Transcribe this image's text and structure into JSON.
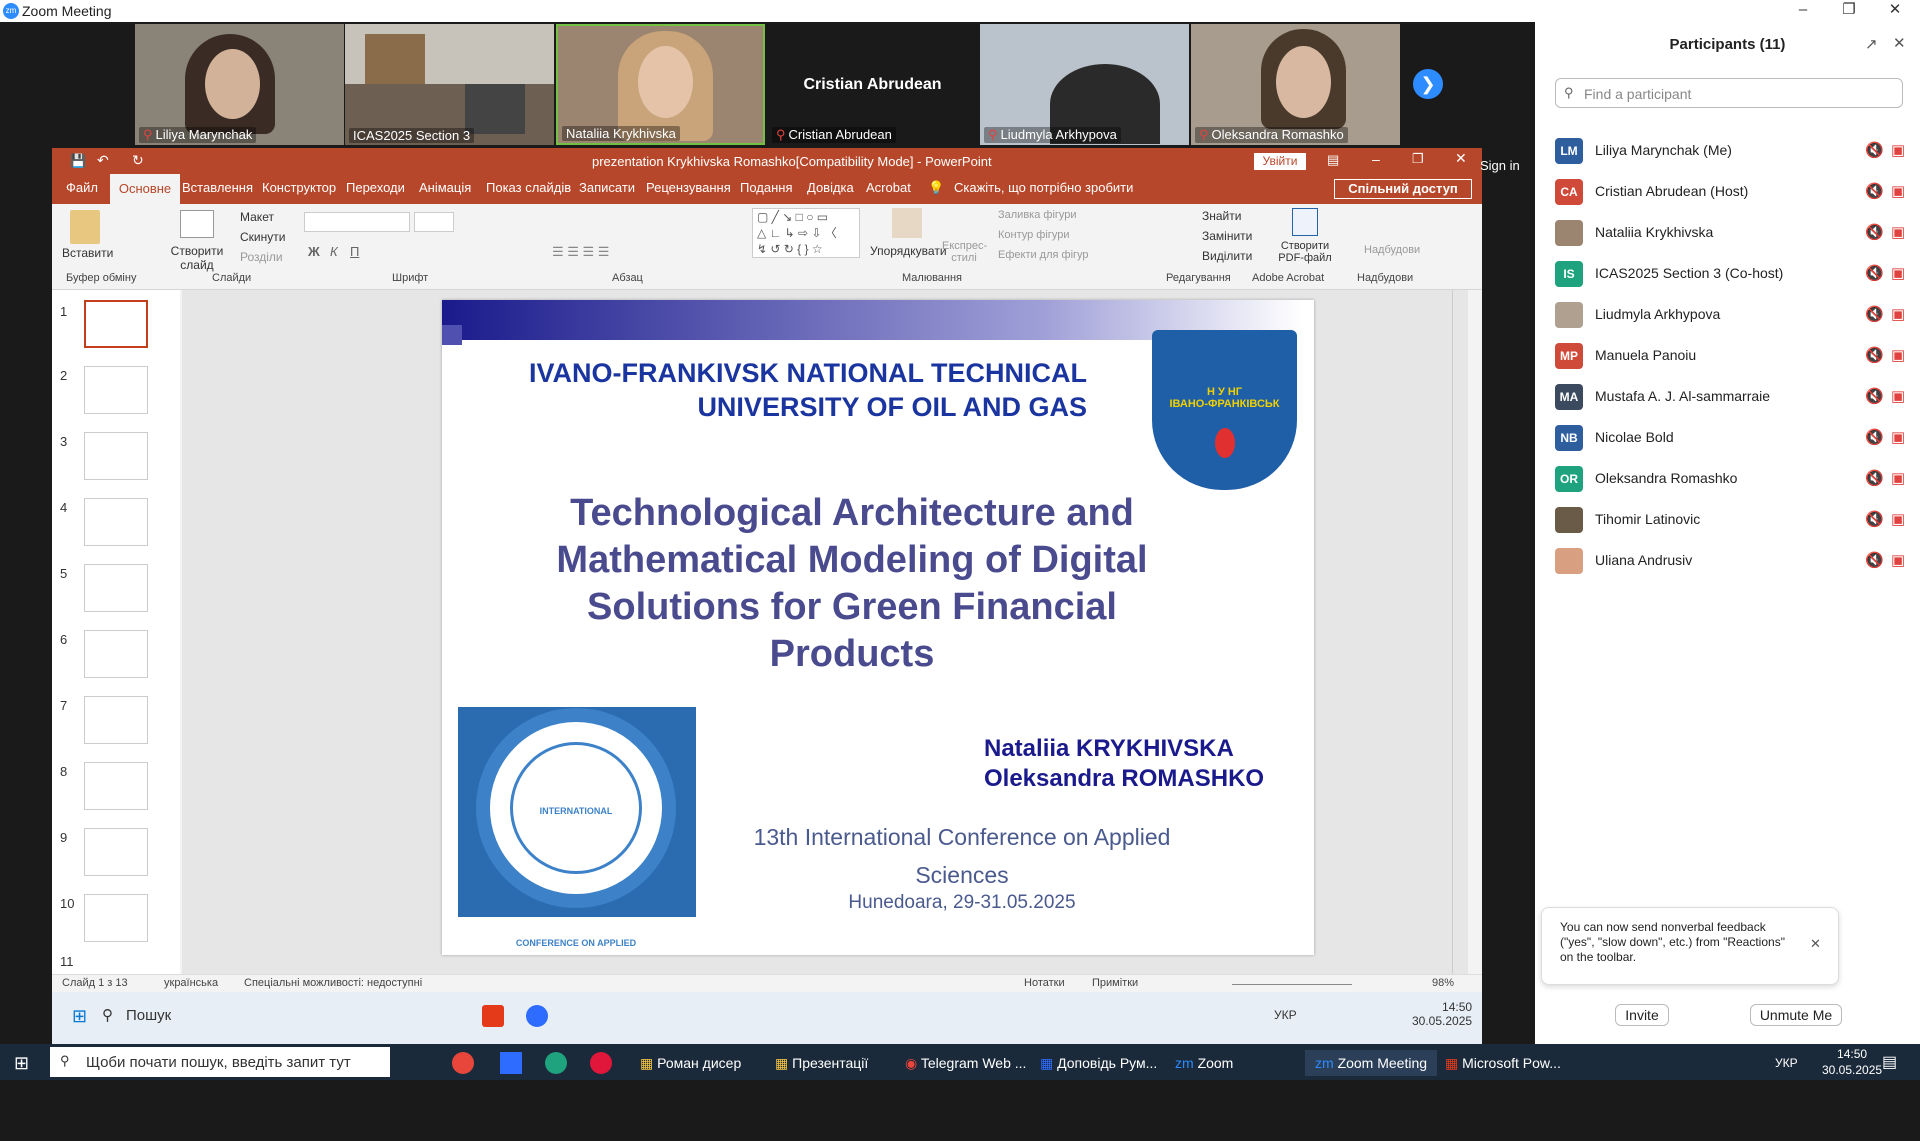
{
  "window": {
    "title": "Zoom Meeting"
  },
  "video": [
    {
      "name": "Liliya Marynchak",
      "muted": true,
      "bg": "#8a8478"
    },
    {
      "name": "ICAS2025 Section 3",
      "muted": false,
      "bg": "#6d5f52"
    },
    {
      "name": "Nataliia Krykhivska",
      "muted": false,
      "bg": "#9b8470"
    },
    {
      "name": "Cristian Abrudean",
      "muted": true,
      "bg": "#1a1a1a",
      "label": "Cristian Abrudean"
    },
    {
      "name": "Liudmyla Arkhypova",
      "muted": true,
      "bg": "#bac3cc"
    },
    {
      "name": "Oleksandra Romashko",
      "muted": true,
      "bg": "#a79c8e"
    }
  ],
  "ppt": {
    "doc_title": "prezentation Krykhivska Romashko[Compatibility Mode]  -  PowerPoint",
    "signin": "Увійти",
    "tabs": [
      "Файл",
      "Основне",
      "Вставлення",
      "Конструктор",
      "Переходи",
      "Анімація",
      "Показ слайдів",
      "Записати",
      "Рецензування",
      "Подання",
      "Довідка",
      "Acrobat"
    ],
    "active_tab": "Основне",
    "tell_me": "Скажіть, що потрібно зробити",
    "share": "Спільний доступ",
    "ribbon": {
      "paste": "Вставити",
      "new_slide": "Створити слайд",
      "layout": "Макет",
      "reset": "Скинути",
      "sections": "Розділи",
      "arrange": "Упорядкувати",
      "express": "Експрес-стилі",
      "fill": "Заливка фігури",
      "outline": "Контур фігури",
      "effects": "Ефекти для фігур",
      "find": "Знайти",
      "replace": "Замінити",
      "select": "Виділити",
      "pdf": "Створити PDF-файл",
      "addins": "Надбудови",
      "groups": [
        "Буфер обміну",
        "Слайди",
        "Шрифт",
        "Абзац",
        "Малювання",
        "Редагування",
        "Adobe Acrobat",
        "Надбудови"
      ]
    },
    "slide": {
      "uni1": "IVANO-FRANKIVSK NATIONAL TECHNICAL",
      "uni2": "UNIVERSITY OF OIL AND GAS",
      "title1": "Technological Architecture and",
      "title2": "Mathematical Modeling of Digital",
      "title3": "Solutions for Green Financial",
      "title4": "Products",
      "author1": "Nataliia KRYKHIVSKA",
      "author2": "Oleksandra ROMASHKO",
      "conf1": "13th International Conference on Applied",
      "conf2": "Sciences",
      "place": "Hunedoara, 29-31.05.2025",
      "emblem_text": "ІВАНО-ФРАНКІВСЬК",
      "emblem_letters": "Н У НГ",
      "logo_text": "INTERNATIONAL CONFERENCE ON APPLIED SCIENCES"
    },
    "thumbs": [
      "1",
      "2",
      "3",
      "4",
      "5",
      "6",
      "7",
      "8",
      "9",
      "10",
      "11"
    ],
    "status": {
      "slide": "Слайд 1 з 13",
      "lang": "українська",
      "access": "Спеціальні можливості: недоступні",
      "notes": "Нотатки",
      "comments": "Примітки",
      "zoom": "98%"
    }
  },
  "inner_taskbar": {
    "search": "Пошук",
    "lang": "УКР",
    "time": "14:50",
    "date": "30.05.2025"
  },
  "panel": {
    "title": "Participants (11)",
    "search_placeholder": "Find a participant",
    "participants": [
      {
        "initials": "LM",
        "name": "Liliya Marynchak (Me)",
        "color": "#2e5e9e"
      },
      {
        "initials": "CA",
        "name": "Cristian Abrudean (Host)",
        "color": "#d04a3a"
      },
      {
        "initials": "",
        "name": "Nataliia Krykhivska",
        "color": "#9b8470"
      },
      {
        "initials": "IS",
        "name": "ICAS2025 Section 3 (Co-host)",
        "color": "#1fa37e"
      },
      {
        "initials": "",
        "name": "Liudmyla Arkhypova",
        "color": "#b0a090"
      },
      {
        "initials": "MP",
        "name": "Manuela Panoiu",
        "color": "#d04a3a"
      },
      {
        "initials": "MA",
        "name": "Mustafa A. J. Al-sammarraie",
        "color": "#3b4a5e"
      },
      {
        "initials": "NB",
        "name": "Nicolae Bold",
        "color": "#2e5e9e"
      },
      {
        "initials": "OR",
        "name": "Oleksandra Romashko",
        "color": "#1fa37e"
      },
      {
        "initials": "",
        "name": "Tihomir Latinovic",
        "color": "#6a5a48"
      },
      {
        "initials": "",
        "name": "Uliana Andrusiv",
        "color": "#d8a080"
      }
    ],
    "tip": "You can now send nonverbal feedback (\"yes\", \"slow down\", etc.) from \"Reactions\" on the toolbar.",
    "invite": "Invite",
    "unmute": "Unmute Me"
  },
  "sign_in": "Sign in",
  "taskbar": {
    "search": "Щоби почати пошук, введіть запит тут",
    "apps": [
      "Роман дисер",
      "Презентації",
      "Telegram Web ...",
      "Доповідь Рум...",
      "Zoom",
      "Zoom Meeting",
      "Microsoft Pow..."
    ],
    "lang": "УКР",
    "time": "14:50",
    "date": "30.05.2025"
  }
}
